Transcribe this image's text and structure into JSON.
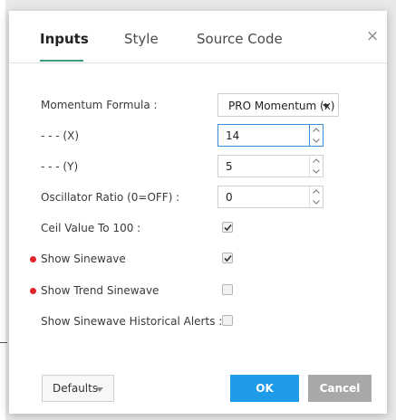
{
  "tabs": [
    "Inputs",
    "Style",
    "Source Code"
  ],
  "close_symbol": "×",
  "fields": {
    "momentum_formula": {
      "label": "Momentum Formula :",
      "value": "PRO Momentum (x)"
    },
    "x": {
      "label": "- - - (X)",
      "value": "14"
    },
    "y": {
      "label": "- - - (Y)",
      "value": "5"
    },
    "oscillator_ratio": {
      "label": "Oscillator Ratio (0=OFF) :",
      "value": "0"
    },
    "ceil_value": {
      "label": "Ceil Value To 100 :",
      "checked": true
    },
    "show_sinewave": {
      "label": "Show Sinewave",
      "checked": true
    },
    "show_trend_sinewave": {
      "label": "Show Trend Sinewave",
      "checked": false
    },
    "show_sinewave_alerts": {
      "label": "Show Sinewave Historical Alerts :",
      "checked": false
    }
  },
  "buttons": {
    "defaults": "Defaults",
    "ok": "OK",
    "cancel": "Cancel"
  },
  "colors": {
    "accent": "#3c9e7a",
    "primary": "#1e9be9",
    "secondary": "#a8a8a8",
    "marker": "#e3232a",
    "focus": "#3b8ed6"
  }
}
